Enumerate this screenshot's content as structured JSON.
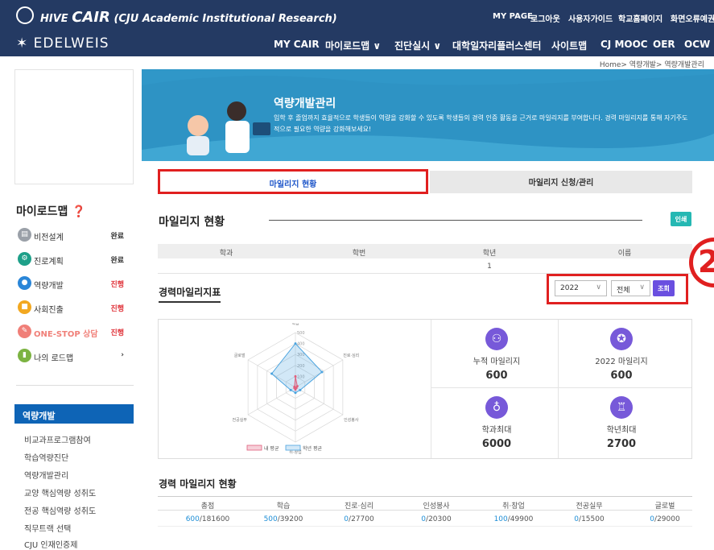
{
  "header": {
    "brand_hive": "HIVE",
    "brand_cair": "CAIR",
    "brand_sub": "(CJU Academic Institutional Research)",
    "top_links": [
      "MY PAGE",
      "로그아웃",
      "사용자가이드",
      "학교홈페이지",
      "화면오류예권"
    ],
    "logo_text": "EDELWEIS",
    "nav": [
      "MY CAIR",
      "마이로드맵 ∨",
      "진단실시 ∨",
      "대학일자리플러스센터",
      "사이트맵",
      "CJ MOOC",
      "OER",
      "OCW"
    ]
  },
  "breadcrumb": "Home> 역량개발> 역량개발관리",
  "roadmap": {
    "title": "마이로드맵",
    "items": [
      {
        "label": "비전설계",
        "status": "완료",
        "color": "#9aa0a8",
        "status_color": "#333333",
        "icon": "document-icon"
      },
      {
        "label": "진로계획",
        "status": "완료",
        "color": "#1ea089",
        "status_color": "#333333",
        "icon": "gear-icon"
      },
      {
        "label": "역량개발",
        "status": "진행",
        "color": "#2a86d8",
        "status_color": "#e0343b",
        "icon": "person-icon"
      },
      {
        "label": "사회진출",
        "status": "진행",
        "color": "#f2a821",
        "status_color": "#e0343b",
        "icon": "briefcase-icon"
      },
      {
        "label": "ONE-STOP 상담",
        "status": "진행",
        "color": "#f07f78",
        "status_color": "#e0343b",
        "icon": "pencil-icon"
      },
      {
        "label": "나의 로드맵",
        "status": "›",
        "color": "#7cb342",
        "status_color": "#333333",
        "icon": "chart-icon"
      }
    ]
  },
  "side_menu": {
    "header": "역량개발",
    "links": [
      "비교과프로그램참여",
      "학습역량진단",
      "역량개발관리",
      "교양 핵심역량 성취도",
      "전공 핵심역량 성취도",
      "직무트랙 선택",
      "CJU 인재인증제"
    ]
  },
  "banner": {
    "title": "역량개발관리",
    "desc": "입학 후 졸업까지 효율적으로 학생들이 역량을 강화할 수 있도록 학생들의 경력 인증 활동을 근거로 마일리지를 부여합니다. 경력 마일리지를 통해 자기주도적으로 필요한 역량을 강화해보세요!"
  },
  "tabs": [
    "마일리지 현황",
    "마일리지 신청/관리"
  ],
  "status_section": {
    "title": "마일리지 현황",
    "button": "인쇄",
    "columns": [
      "학과",
      "학번",
      "학년",
      "이름"
    ],
    "row": [
      "",
      "",
      "1",
      ""
    ]
  },
  "indicator": {
    "title": "경력마일리지표",
    "year": "2022",
    "category": "전체",
    "search": "조회",
    "annotation": "2"
  },
  "chart_data": {
    "type": "radar",
    "axes": [
      "학습",
      "진로·심리",
      "인성봉사",
      "취·창업",
      "전공실무",
      "글로벌"
    ],
    "tick_labels": [
      "100",
      "200",
      "300",
      "400",
      "500"
    ],
    "range": [
      0,
      500
    ],
    "legend": [
      "내 평균",
      "학년 평균"
    ],
    "colors": {
      "mine": "#e0607d",
      "grade": "#4aa3df"
    },
    "series": [
      {
        "name": "내 평균",
        "values": [
          100,
          20,
          10,
          20,
          10,
          10
        ]
      },
      {
        "name": "학년 평균",
        "values": [
          400,
          280,
          50,
          50,
          50,
          250
        ]
      }
    ]
  },
  "stats": [
    {
      "label": "누적 마일리지",
      "value": "600",
      "icon": "person-icon"
    },
    {
      "label": "2022 마일리지",
      "value": "600",
      "icon": "medal-icon"
    },
    {
      "label": "학과최대",
      "value": "6000",
      "icon": "lightbulb-icon"
    },
    {
      "label": "학년최대",
      "value": "2700",
      "icon": "trophy-icon"
    }
  ],
  "mileage_status": {
    "title": "경력 마일리지 현황",
    "columns": [
      "총점",
      "학습",
      "진로·심리",
      "인성봉사",
      "취·창업",
      "전공실무",
      "글로벌"
    ],
    "values": [
      {
        "a": "600",
        "b": "/181600"
      },
      {
        "a": "500",
        "b": "/39200"
      },
      {
        "a": "0",
        "b": "/27700"
      },
      {
        "a": "0",
        "b": "/20300"
      },
      {
        "a": "100",
        "b": "/49900"
      },
      {
        "a": "0",
        "b": "/15500"
      },
      {
        "a": "0",
        "b": "/29000"
      }
    ]
  }
}
